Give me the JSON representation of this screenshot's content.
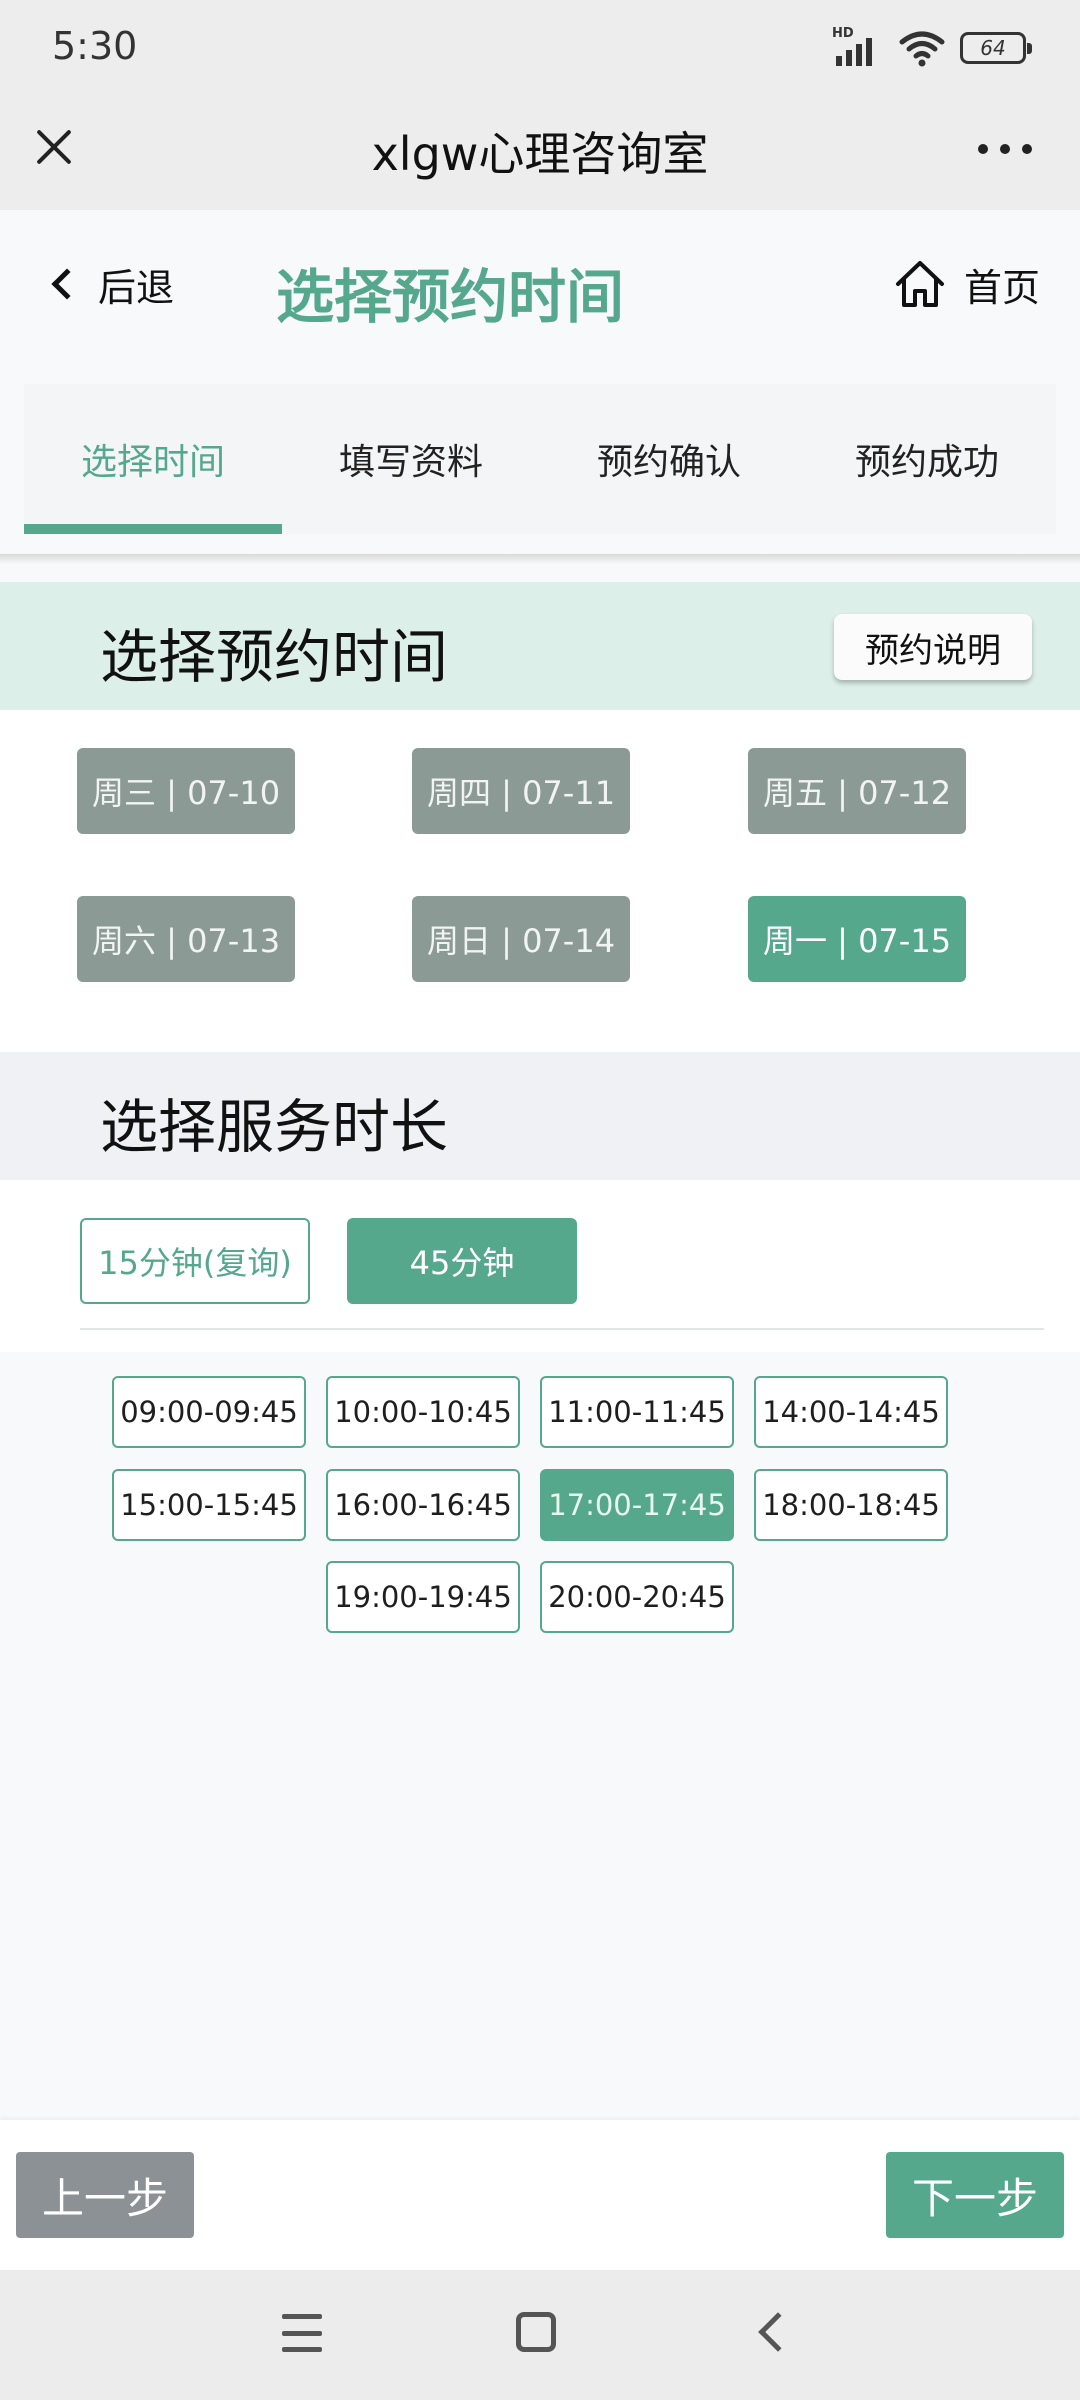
{
  "status_bar": {
    "time": "5:30",
    "network": "HD",
    "battery": "64"
  },
  "title_bar": {
    "title": "xlgw心理咨询室"
  },
  "header": {
    "back_label": "后退",
    "title": "选择预约时间",
    "home_label": "首页"
  },
  "steps": [
    {
      "label": "选择时间",
      "active": true
    },
    {
      "label": "填写资料",
      "active": false
    },
    {
      "label": "预约确认",
      "active": false
    },
    {
      "label": "预约成功",
      "active": false
    }
  ],
  "time_section": {
    "title": "选择预约时间",
    "info_button": "预约说明"
  },
  "dates": [
    {
      "label": "周三 | 07-10",
      "selected": false
    },
    {
      "label": "周四 | 07-11",
      "selected": false
    },
    {
      "label": "周五 | 07-12",
      "selected": false
    },
    {
      "label": "周六 | 07-13",
      "selected": false
    },
    {
      "label": "周日 | 07-14",
      "selected": false
    },
    {
      "label": "周一 | 07-15",
      "selected": true
    }
  ],
  "duration_section": {
    "title": "选择服务时长"
  },
  "durations": [
    {
      "label": "15分钟(复询)",
      "selected": false
    },
    {
      "label": "45分钟",
      "selected": true
    }
  ],
  "slots": [
    {
      "label": "09:00-09:45",
      "selected": false
    },
    {
      "label": "10:00-10:45",
      "selected": false
    },
    {
      "label": "11:00-11:45",
      "selected": false
    },
    {
      "label": "14:00-14:45",
      "selected": false
    },
    {
      "label": "15:00-15:45",
      "selected": false
    },
    {
      "label": "16:00-16:45",
      "selected": false
    },
    {
      "label": "17:00-17:45",
      "selected": true
    },
    {
      "label": "18:00-18:45",
      "selected": false
    },
    {
      "label": "19:00-19:45",
      "selected": false
    },
    {
      "label": "20:00-20:45",
      "selected": false
    }
  ],
  "actions": {
    "prev": "上一步",
    "next": "下一步"
  },
  "colors": {
    "accent": "#55a88c",
    "date_inactive": "#8b9a95",
    "prev_button": "#8c9195"
  }
}
